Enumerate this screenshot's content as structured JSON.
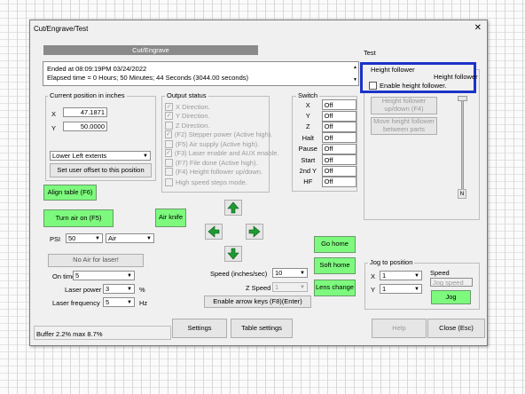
{
  "window": {
    "title": "Cut/Engrave/Test",
    "close_glyph": "✕"
  },
  "tabs": {
    "cut_engrave": "Cut/Engrave",
    "test": "Test"
  },
  "log": {
    "line1": "Ended at 08:09:19PM 03/24/2022",
    "line2": "Elapsed time = 0 Hours; 50 Minutes; 44 Seconds (3044.00 seconds)"
  },
  "position": {
    "group_label": "Current position in inches",
    "x_label": "X",
    "x_value": "47.1871",
    "y_label": "Y",
    "y_value": "50.0000",
    "extents": "Lower Left extents",
    "set_offset": "Set user offset to this position"
  },
  "output_status": {
    "group_label": "Output status",
    "items": [
      "X Direction.",
      "Y Direction.",
      "Z Direction.",
      "(F2) Stepper power (Active high).",
      "(F5) Air supply (Active high).",
      "(F3) Laser enable and AUX enable.",
      "(F7) File done (Active high).",
      "(F4) Height follower up/down."
    ],
    "checked": [
      true,
      true,
      false,
      true,
      false,
      true,
      false,
      false
    ],
    "high_speed": "High speed steps mode."
  },
  "switch": {
    "group_label": "Switch",
    "rows": [
      {
        "label": "X",
        "value": "Off"
      },
      {
        "label": "Y",
        "value": "Off"
      },
      {
        "label": "Z",
        "value": "Off"
      },
      {
        "label": "Halt",
        "value": "Off"
      },
      {
        "label": "Pause",
        "value": "Off"
      },
      {
        "label": "Start",
        "value": "Off"
      },
      {
        "label": "2nd Y",
        "value": "Off"
      },
      {
        "label": "HF",
        "value": "Off"
      }
    ]
  },
  "height_follower": {
    "group_label": "Height follower",
    "callout_label": "Height follower",
    "enable_label": "Enable height follower.",
    "updown_button": "Height follower up/down (F4)",
    "move_button": "Move height follower between parts",
    "slider_label": "N"
  },
  "controls": {
    "align_table": "Align table (F6)",
    "turn_air": "Turn air on (F5)",
    "air_knife": "Air knife",
    "psi_label": "PSI",
    "psi_value": "50",
    "gas_value": "Air",
    "no_air": "No Air for laser!",
    "on_time_label": "On time",
    "on_time_value": "5",
    "laser_power_label": "Laser power",
    "laser_power_value": "3",
    "laser_power_unit": "%",
    "laser_freq_label": "Laser frequency",
    "laser_freq_value": "5",
    "laser_freq_unit": "Hz"
  },
  "motion": {
    "speed_label": "Speed (inches/sec)",
    "speed_value": "10",
    "z_speed_label": "Z Speed",
    "z_speed_value": "1",
    "enable_arrows": "Enable arrow keys (F8)(Enter)",
    "go_home": "Go home",
    "soft_home": "Soft home",
    "lens_change": "Lens change"
  },
  "jog": {
    "group_label": "Jog to position",
    "x_label": "X",
    "x_value": "1",
    "y_label": "Y",
    "y_value": "1",
    "speed_label": "Speed",
    "speed_placeholder": "Jog speed",
    "jog_button": "Jog"
  },
  "bottom": {
    "buffer": "Buffer  2.2% max  8.7%",
    "settings": "Settings",
    "table_settings": "Table settings",
    "help": "Help",
    "close": "Close (Esc)"
  },
  "colors": {
    "green": "#7dfa7d",
    "highlight": "#1c33c8",
    "tab_bar": "#8a8a8a"
  },
  "icons": [
    "up-arrow-icon",
    "down-arrow-icon",
    "left-arrow-icon",
    "right-arrow-icon",
    "close-icon",
    "dropdown-arrow-icon"
  ]
}
